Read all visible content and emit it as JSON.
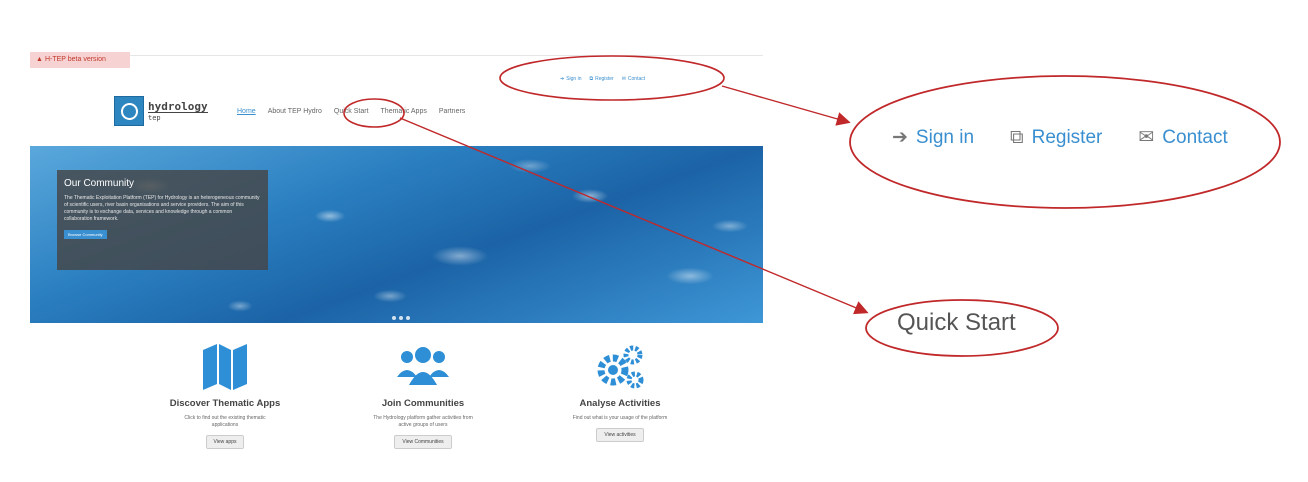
{
  "beta_banner": "H-TEP beta version",
  "top_links": [
    "Sign in",
    "Register",
    "Contact"
  ],
  "logo": {
    "line1": "hydrology",
    "line2": "tep"
  },
  "nav": [
    "Home",
    "About TEP Hydro",
    "Quick Start",
    "Thematic Apps",
    "Partners"
  ],
  "community": {
    "title": "Our Community",
    "text": "The Thematic Exploitation Platform (TEP) for Hydrology is an heterogeneous community of scientific users, river basin organisations and service providers. The aim of this community is to exchange data, services and knowledge through a common collaboration framework.",
    "button": "Browse Community"
  },
  "features": [
    {
      "title": "Discover Thematic Apps",
      "text": "Click to find out the existing thematic applications",
      "button": "View apps"
    },
    {
      "title": "Join Communities",
      "text": "The Hydrology platform gather activities from active groups of users",
      "button": "View Communities"
    },
    {
      "title": "Analyse Activities",
      "text": "Find out what is your usage of the platform",
      "button": "View activities"
    }
  ],
  "callout_links": [
    "Sign in",
    "Register",
    "Contact"
  ],
  "callout_quick_start": "Quick Start",
  "colors": {
    "accent": "#3a8fd0",
    "annotation": "#c0282a"
  }
}
